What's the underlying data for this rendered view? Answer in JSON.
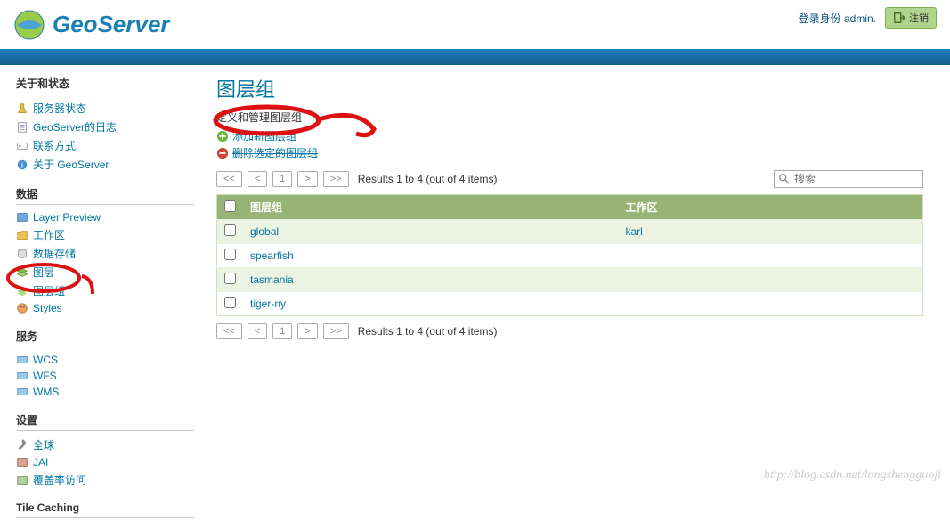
{
  "header": {
    "brand": "GeoServer",
    "login_text": "登录身份 admin.",
    "logout_label": "注销"
  },
  "sidebar": {
    "sections": [
      {
        "title": "关于和状态",
        "items": [
          {
            "label": "服务器状态"
          },
          {
            "label": "GeoServer的日志"
          },
          {
            "label": "联系方式"
          },
          {
            "label": "关于 GeoServer"
          }
        ]
      },
      {
        "title": "数据",
        "items": [
          {
            "label": "Layer Preview"
          },
          {
            "label": "工作区"
          },
          {
            "label": "数据存储"
          },
          {
            "label": "图层"
          },
          {
            "label": "图层组"
          },
          {
            "label": "Styles"
          }
        ]
      },
      {
        "title": "服务",
        "items": [
          {
            "label": "WCS"
          },
          {
            "label": "WFS"
          },
          {
            "label": "WMS"
          }
        ]
      },
      {
        "title": "设置",
        "items": [
          {
            "label": "全球"
          },
          {
            "label": "JAI"
          },
          {
            "label": "覆盖率访问"
          }
        ]
      },
      {
        "title": "Tile Caching",
        "items": []
      }
    ]
  },
  "page": {
    "title": "图层组",
    "subtitle": "定义和管理图层组",
    "add_label": "添加新图层组",
    "remove_label": "删除选定的图层组"
  },
  "pager": {
    "first": "<<",
    "prev": "<",
    "page": "1",
    "next": ">",
    "last": ">>",
    "results_text": "Results 1 to 4 (out of 4 items)"
  },
  "search": {
    "placeholder": "搜索"
  },
  "table": {
    "col_group": "图层组",
    "col_workspace": "工作区",
    "rows": [
      {
        "name": "global",
        "workspace": "karl"
      },
      {
        "name": "spearfish",
        "workspace": ""
      },
      {
        "name": "tasmania",
        "workspace": ""
      },
      {
        "name": "tiger-ny",
        "workspace": ""
      }
    ]
  },
  "watermark": "http://blog.csdn.net/longshengguoji"
}
